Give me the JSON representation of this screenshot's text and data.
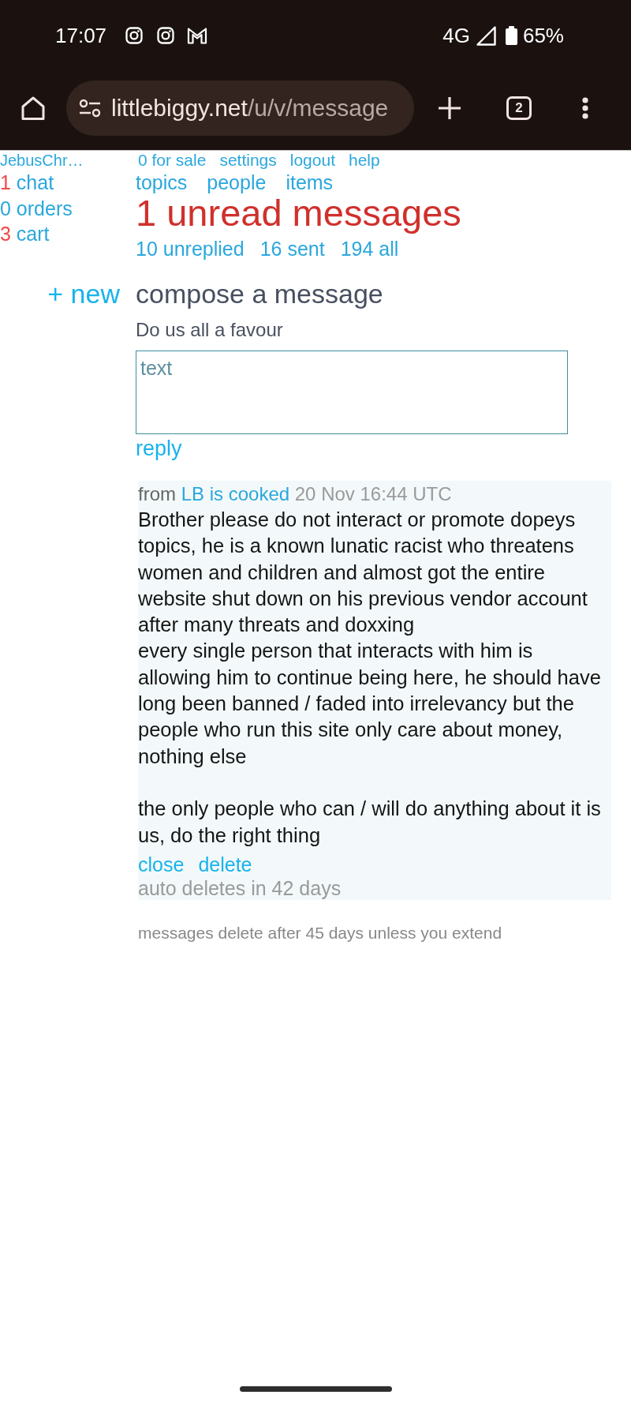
{
  "status_bar": {
    "time": "17:07",
    "network": "4G",
    "battery": "65%"
  },
  "browser": {
    "url_host": "littlebiggy.net",
    "url_path": "/u/v/message",
    "tab_count": "2"
  },
  "sidebar": {
    "username": "JebusChr…",
    "items": [
      {
        "count": "1",
        "label": "chat",
        "alert": true
      },
      {
        "count": "0",
        "label": "orders",
        "alert": false
      },
      {
        "count": "3",
        "label": "cart",
        "alert": true
      }
    ]
  },
  "account_links": [
    "0 for sale",
    "settings",
    "logout",
    "help"
  ],
  "nav_links": [
    "topics",
    "people",
    "items"
  ],
  "heading": "1 unread messages",
  "filters": [
    "10 unreplied",
    "16 sent",
    "194 all"
  ],
  "new_link": "+ new",
  "compose": {
    "title": "compose a message",
    "hint": "Do us all a favour",
    "placeholder": "text",
    "submit": "reply"
  },
  "messages": [
    {
      "from_label": "from",
      "sender": "LB is cooked",
      "time": "20 Nov 16:44 UTC",
      "body": "Brother please do not interact or promote dopeys topics, he is a known lunatic racist who threatens women and children and almost got the entire website shut down on his previous vendor account after many threats and doxxing\nevery single person that interacts with him is allowing him to continue being here, he should have long been banned / faded into irrelevancy but the people who run this site only care about money, nothing else\n\nthe only people who can / will do anything about it is us, do the right thing",
      "actions": [
        "close",
        "delete"
      ],
      "expiry": "auto deletes in 42 days"
    }
  ],
  "footer_note": "messages delete after 45 days unless you extend"
}
